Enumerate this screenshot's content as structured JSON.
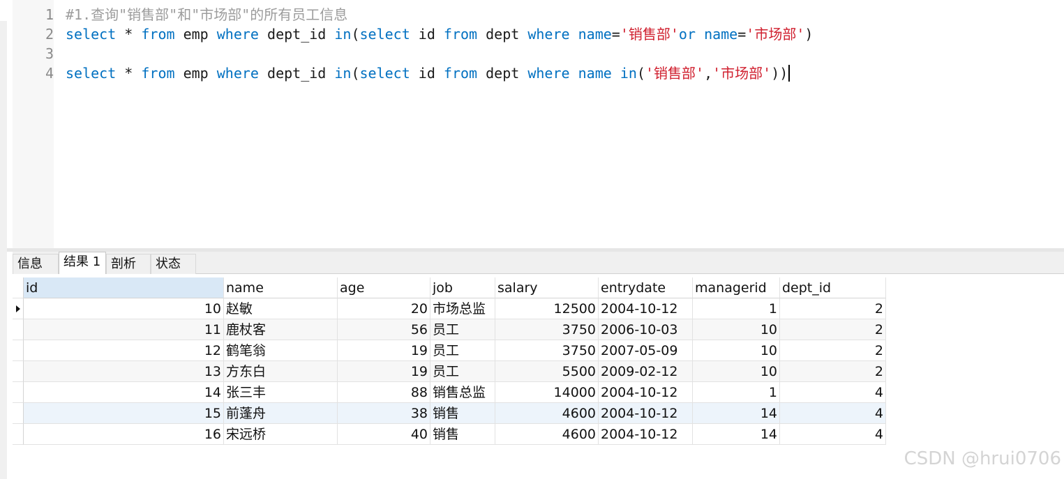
{
  "editor": {
    "line_numbers": [
      "1",
      "2",
      "3",
      "4"
    ],
    "lines": [
      [
        {
          "t": "#1.查询\"销售部\"和\"市场部\"的所有员工信息",
          "c": "cmt"
        }
      ],
      [
        {
          "t": "select",
          "c": "kw"
        },
        {
          "t": " * ",
          "c": "plain"
        },
        {
          "t": "from",
          "c": "kw"
        },
        {
          "t": " emp ",
          "c": "plain"
        },
        {
          "t": "where",
          "c": "kw"
        },
        {
          "t": " dept_id ",
          "c": "plain"
        },
        {
          "t": "in",
          "c": "kw"
        },
        {
          "t": "(",
          "c": "plain"
        },
        {
          "t": "select",
          "c": "kw"
        },
        {
          "t": " id ",
          "c": "plain"
        },
        {
          "t": "from",
          "c": "kw"
        },
        {
          "t": " dept ",
          "c": "plain"
        },
        {
          "t": "where",
          "c": "kw"
        },
        {
          "t": " ",
          "c": "plain"
        },
        {
          "t": "name",
          "c": "kw"
        },
        {
          "t": "=",
          "c": "plain"
        },
        {
          "t": "'销售部'",
          "c": "str"
        },
        {
          "t": "or",
          "c": "kw"
        },
        {
          "t": " ",
          "c": "plain"
        },
        {
          "t": "name",
          "c": "kw"
        },
        {
          "t": "=",
          "c": "plain"
        },
        {
          "t": "'市场部'",
          "c": "str"
        },
        {
          "t": ")",
          "c": "plain"
        }
      ],
      [],
      [
        {
          "t": "select",
          "c": "kw"
        },
        {
          "t": " * ",
          "c": "plain"
        },
        {
          "t": "from",
          "c": "kw"
        },
        {
          "t": " emp ",
          "c": "plain"
        },
        {
          "t": "where",
          "c": "kw"
        },
        {
          "t": " dept_id ",
          "c": "plain"
        },
        {
          "t": "in",
          "c": "kw"
        },
        {
          "t": "(",
          "c": "plain"
        },
        {
          "t": "select",
          "c": "kw"
        },
        {
          "t": " id ",
          "c": "plain"
        },
        {
          "t": "from",
          "c": "kw"
        },
        {
          "t": " dept ",
          "c": "plain"
        },
        {
          "t": "where",
          "c": "kw"
        },
        {
          "t": " ",
          "c": "plain"
        },
        {
          "t": "name",
          "c": "kw"
        },
        {
          "t": " ",
          "c": "plain"
        },
        {
          "t": "in",
          "c": "kw"
        },
        {
          "t": "(",
          "c": "plain"
        },
        {
          "t": "'销售部'",
          "c": "str"
        },
        {
          "t": ",",
          "c": "plain"
        },
        {
          "t": "'市场部'",
          "c": "str"
        },
        {
          "t": "))",
          "c": "plain"
        }
      ]
    ],
    "colors": {
      "keyword": "#0070c1",
      "string": "#d0202f",
      "comment": "#9c9c9c",
      "text": "#1a1a1a"
    }
  },
  "tabs": [
    {
      "label": "信息",
      "active": false
    },
    {
      "label": "结果 1",
      "active": true
    },
    {
      "label": "剖析",
      "active": false
    },
    {
      "label": "状态",
      "active": false
    }
  ],
  "results": {
    "columns": [
      "id",
      "name",
      "age",
      "job",
      "salary",
      "entrydate",
      "managerid",
      "dept_id"
    ],
    "rows": [
      [
        "10",
        "赵敏",
        "20",
        "市场总监",
        "12500",
        "2004-10-12",
        "1",
        "2"
      ],
      [
        "11",
        "鹿杖客",
        "56",
        "员工",
        "3750",
        "2006-10-03",
        "10",
        "2"
      ],
      [
        "12",
        "鹤笔翁",
        "19",
        "员工",
        "3750",
        "2007-05-09",
        "10",
        "2"
      ],
      [
        "13",
        "方东白",
        "19",
        "员工",
        "5500",
        "2009-02-12",
        "10",
        "2"
      ],
      [
        "14",
        "张三丰",
        "88",
        "销售总监",
        "14000",
        "2004-10-12",
        "1",
        "4"
      ],
      [
        "15",
        "前蓬舟",
        "38",
        "销售",
        "4600",
        "2004-10-12",
        "14",
        "4"
      ],
      [
        "16",
        "宋远桥",
        "40",
        "销售",
        "4600",
        "2004-10-12",
        "14",
        "4"
      ]
    ],
    "highlight_row_index": 5,
    "current_row_index": 0
  },
  "watermark": "CSDN @hrui0706"
}
